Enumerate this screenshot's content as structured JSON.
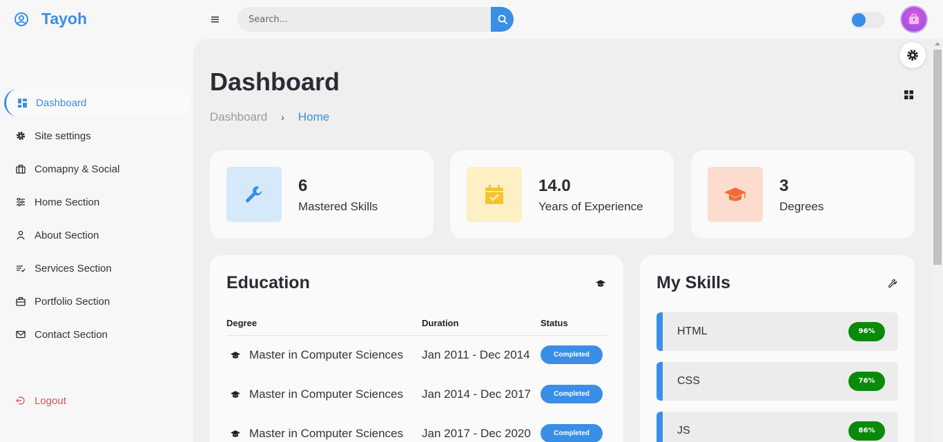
{
  "brand": {
    "name": "Tayoh"
  },
  "search": {
    "placeholder": "Search..."
  },
  "sidebar": {
    "items": [
      {
        "label": "Dashboard",
        "icon": "dashboard-icon",
        "active": true
      },
      {
        "label": "Site settings",
        "icon": "gear-icon"
      },
      {
        "label": "Comapny & Social",
        "icon": "briefcase-icon"
      },
      {
        "label": "Home Section",
        "icon": "sliders-icon"
      },
      {
        "label": "About Section",
        "icon": "user-icon"
      },
      {
        "label": "Services Section",
        "icon": "list-icon"
      },
      {
        "label": "Portfolio Section",
        "icon": "portfolio-icon"
      },
      {
        "label": "Contact Section",
        "icon": "envelope-icon"
      }
    ],
    "logout": {
      "label": "Logout",
      "icon": "logout-icon"
    }
  },
  "header": {
    "title": "Dashboard",
    "breadcrumb": [
      "Dashboard",
      "Home"
    ]
  },
  "stats": [
    {
      "value": "6",
      "label": "Mastered Skills",
      "icon": "wrench-icon",
      "color": "#3a8ee6",
      "bg": "#d6e9fb"
    },
    {
      "value": "14.0",
      "label": "Years of Experience",
      "icon": "calendar-check-icon",
      "color": "#f3c330",
      "bg": "#fdf0c4"
    },
    {
      "value": "3",
      "label": "Degrees",
      "icon": "graduation-cap-icon",
      "color": "#f26a36",
      "bg": "#fcdccf"
    }
  ],
  "education": {
    "title": "Education",
    "columns": [
      "Degree",
      "Duration",
      "Status"
    ],
    "rows": [
      {
        "degree": "Master in Computer Sciences",
        "duration": "Jan 2011 - Dec 2014",
        "status": "Completed"
      },
      {
        "degree": "Master in Computer Sciences",
        "duration": "Jan 2014 - Dec 2017",
        "status": "Completed"
      },
      {
        "degree": "Master in Computer Sciences",
        "duration": "Jan 2017 - Dec 2020",
        "status": "Completed"
      }
    ]
  },
  "skills": {
    "title": "My Skills",
    "items": [
      {
        "name": "HTML",
        "percent": "96%"
      },
      {
        "name": "CSS",
        "percent": "76%"
      },
      {
        "name": "JS",
        "percent": "86%"
      }
    ]
  },
  "colors": {
    "accent": "#3a8ee6",
    "success": "#0a8a0a",
    "logout": "#d9534f"
  }
}
